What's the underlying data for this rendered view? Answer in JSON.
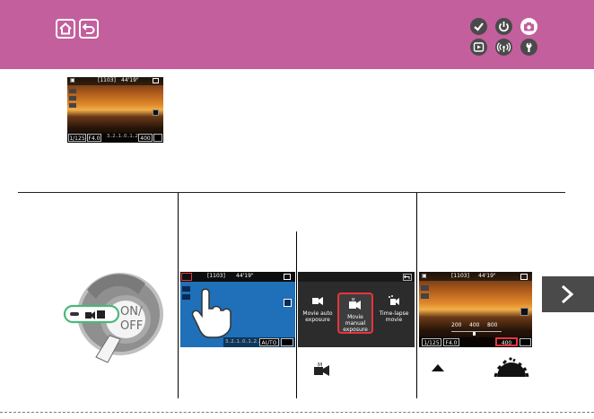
{
  "header": {
    "home_icon": "home-icon",
    "back_icon": "back-arrow-icon",
    "category_icons": [
      "checkmark-icon",
      "power-icon",
      "camera-icon",
      "playback-icon",
      "wireless-icon",
      "wrench-icon"
    ],
    "active_icon": "camera-icon",
    "colors": {
      "header": "#c45f9e",
      "active": "#ffffff",
      "inactive": "#4a4a4a"
    }
  },
  "preview": {
    "top_status": "[1103]",
    "time": "44'19\"",
    "shutter": "1/125",
    "aperture": "F4.0",
    "iso": "400",
    "scale": "3..2..1..0..1..2..3"
  },
  "dial": {
    "power_label_on": "ON/",
    "power_label_off": "OFF"
  },
  "step2": {
    "top_status": "[1103]",
    "time": "44'19\"",
    "iso": "AUTO",
    "scale": "3..2..1..0..1..2..3",
    "accent": "#1f6fb9"
  },
  "step3": {
    "modes": [
      {
        "label": "Movie auto exposure",
        "icon": "movie-auto-icon",
        "selected": false
      },
      {
        "label": "Movie manual exposure",
        "icon": "movie-manual-icon",
        "selected": true
      },
      {
        "label": "Time-lapse movie",
        "icon": "time-lapse-icon",
        "selected": false
      }
    ]
  },
  "step4": {
    "top_status": "[1103]",
    "time": "44'19\"",
    "shutter": "1/125",
    "aperture": "F4.0",
    "iso_scale": [
      "200",
      "400",
      "800"
    ],
    "iso_selected": "400"
  },
  "next_button": {
    "icon": "chevron-right-icon",
    "color": "#4a4a4a"
  }
}
